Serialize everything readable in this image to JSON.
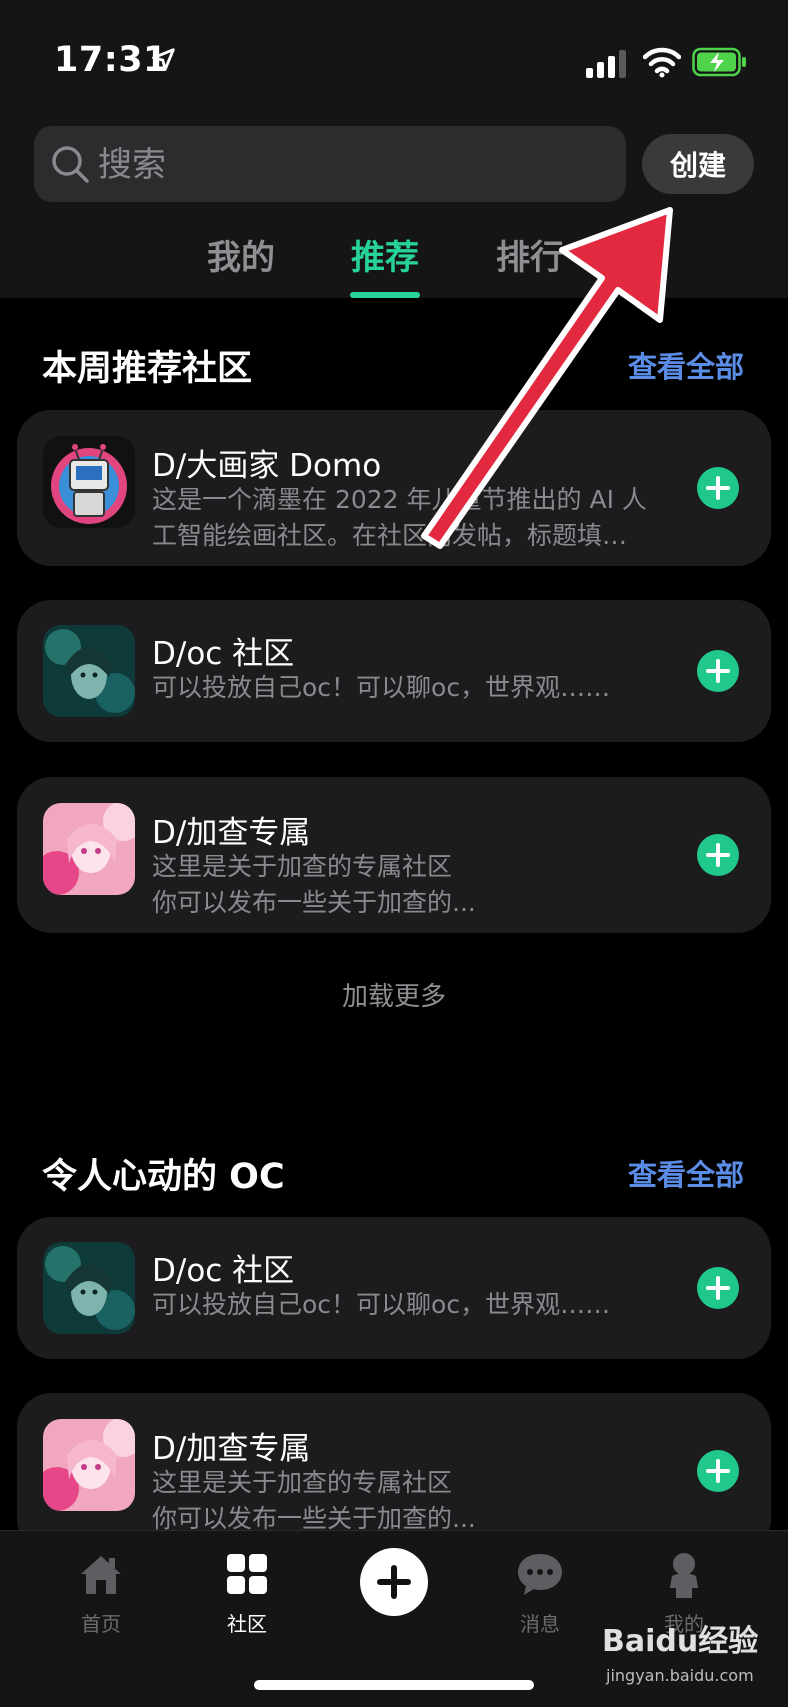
{
  "status_bar": {
    "time": "17:31"
  },
  "search": {
    "placeholder": "搜索"
  },
  "create_label": "创建",
  "tabs": [
    {
      "label": "我的",
      "active": false
    },
    {
      "label": "推荐",
      "active": true
    },
    {
      "label": "排行",
      "active": false
    }
  ],
  "accent_color": "#27d39a",
  "link_color": "#5b8de6",
  "section1": {
    "title": "本周推荐社区",
    "see_all": "查看全部",
    "cards": [
      {
        "name": "D/大画家 Domo",
        "desc": [
          "这是一个滴墨在 2022 年儿童节推出的 AI 人",
          "工智能绘画社区。在社区内发帖，标题填…"
        ],
        "avatar": "robot-avatar"
      },
      {
        "name": "D/oc 社区",
        "desc": [
          "可以投放自己oc！可以聊oc，世界观……"
        ],
        "avatar": "oc-avatar"
      },
      {
        "name": "D/加查专属",
        "desc": [
          "这里是关于加查的专属社区",
          "你可以发布一些关于加查的..."
        ],
        "avatar": "gacha-avatar"
      }
    ]
  },
  "load_more": "加载更多",
  "section2": {
    "title": "令人心动的 OC",
    "see_all": "查看全部",
    "cards": [
      {
        "name": "D/oc 社区",
        "desc": [
          "可以投放自己oc！可以聊oc，世界观……"
        ],
        "avatar": "oc-avatar"
      },
      {
        "name": "D/加查专属",
        "desc": [
          "这里是关于加查的专属社区",
          "你可以发布一些关于加查的..."
        ],
        "avatar": "gacha-avatar"
      }
    ]
  },
  "bottom_nav": [
    {
      "label": "首页",
      "icon": "home-icon",
      "active": false
    },
    {
      "label": "社区",
      "icon": "grid-icon",
      "active": true
    },
    {
      "label": "",
      "icon": "plus-icon",
      "active": false
    },
    {
      "label": "消息",
      "icon": "chat-icon",
      "active": false
    },
    {
      "label": "我的",
      "icon": "person-icon",
      "active": false
    }
  ],
  "watermark": {
    "brand": "Baidu经验",
    "url": "jingyan.baidu.com"
  }
}
